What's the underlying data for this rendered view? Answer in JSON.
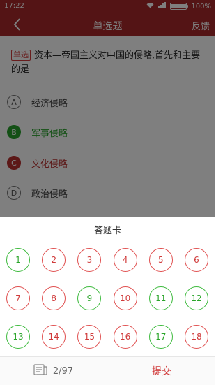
{
  "status_bar": {
    "time": "17:22",
    "battery": "100%"
  },
  "nav": {
    "title": "单选题",
    "feedback": "反馈",
    "back_icon": "chevron-left-icon"
  },
  "question": {
    "tag": "单选",
    "text": "资本—帝国主义对中国的侵略,首先和主要的是",
    "options": [
      {
        "letter": "A",
        "text": "经济侵略",
        "state": "normal"
      },
      {
        "letter": "B",
        "text": "军事侵略",
        "state": "correct"
      },
      {
        "letter": "C",
        "text": "文化侵略",
        "state": "wrong"
      },
      {
        "letter": "D",
        "text": "政治侵略",
        "state": "normal"
      }
    ]
  },
  "answer_card": {
    "title": "答题卡",
    "items": [
      {
        "n": "1",
        "state": "correct"
      },
      {
        "n": "2",
        "state": "wrong"
      },
      {
        "n": "3",
        "state": "wrong"
      },
      {
        "n": "4",
        "state": "wrong"
      },
      {
        "n": "5",
        "state": "wrong"
      },
      {
        "n": "6",
        "state": "wrong"
      },
      {
        "n": "7",
        "state": "wrong"
      },
      {
        "n": "8",
        "state": "wrong"
      },
      {
        "n": "9",
        "state": "correct"
      },
      {
        "n": "10",
        "state": "wrong"
      },
      {
        "n": "11",
        "state": "correct"
      },
      {
        "n": "12",
        "state": "correct"
      },
      {
        "n": "13",
        "state": "correct"
      },
      {
        "n": "14",
        "state": "wrong"
      },
      {
        "n": "15",
        "state": "wrong"
      },
      {
        "n": "16",
        "state": "wrong"
      },
      {
        "n": "17",
        "state": "correct"
      },
      {
        "n": "18",
        "state": "wrong"
      }
    ]
  },
  "bottom": {
    "progress": "2/97",
    "submit": "提交"
  },
  "colors": {
    "brand": "#a8282b",
    "correct": "#27a12a",
    "wrong": "#d03a3a"
  }
}
